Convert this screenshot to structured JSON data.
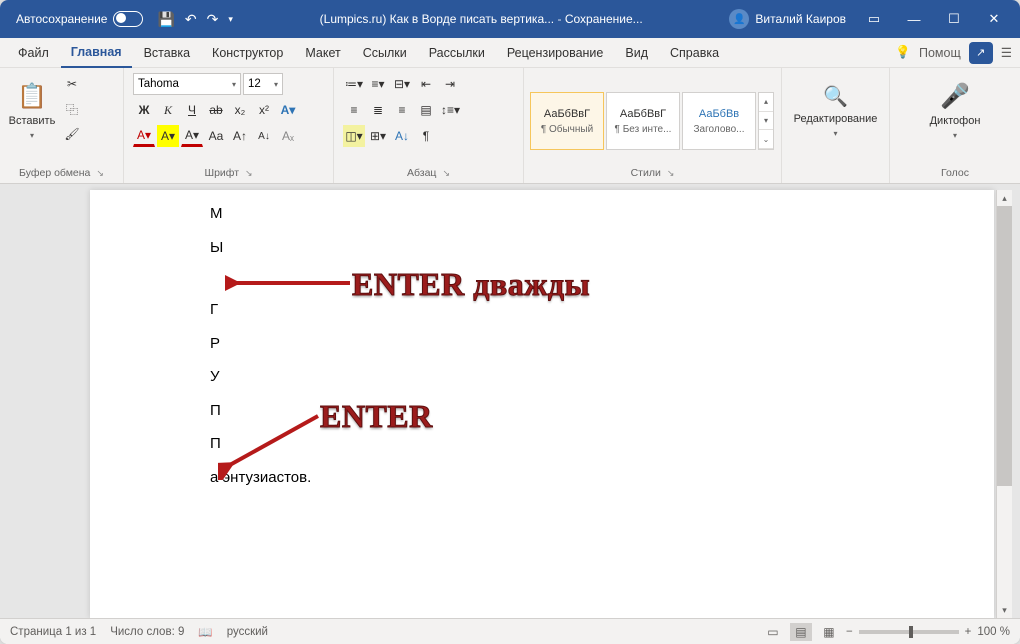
{
  "titlebar": {
    "autosave_label": "Автосохранение",
    "title": "(Lumpics.ru) Как в Ворде писать вертика...",
    "saving": "Сохранение...",
    "user": "Виталий Каиров"
  },
  "tabs": {
    "file": "Файл",
    "home": "Главная",
    "insert": "Вставка",
    "design": "Конструктор",
    "layout": "Макет",
    "references": "Ссылки",
    "mailings": "Рассылки",
    "review": "Рецензирование",
    "view": "Вид",
    "help": "Справка",
    "search": "Помощ"
  },
  "ribbon": {
    "clipboard": {
      "label": "Буфер обмена",
      "paste": "Вставить"
    },
    "font": {
      "label": "Шрифт",
      "name": "Tahoma",
      "size": "12",
      "bold": "Ж",
      "italic": "К",
      "underline": "Ч",
      "strike": "ab",
      "sub": "x₂",
      "sup": "x²",
      "color": "А",
      "highlight": "А",
      "effects": "А",
      "case": "Aa",
      "grow": "A",
      "shrink": "A",
      "clear": "A"
    },
    "paragraph": {
      "label": "Абзац"
    },
    "styles": {
      "label": "Стили",
      "items": [
        {
          "preview": "АаБбВвГ",
          "name": "¶ Обычный"
        },
        {
          "preview": "АаБбВвГ",
          "name": "¶ Без инте..."
        },
        {
          "preview": "АаБбВв",
          "name": "Заголово..."
        }
      ]
    },
    "editing": {
      "label": "Редактирование"
    },
    "voice": {
      "label": "Голос",
      "dictate": "Диктофон"
    }
  },
  "document": {
    "lines": [
      "М",
      "Ы",
      "",
      "Г",
      "Р",
      "У",
      "П",
      "П",
      "а энтузиастов."
    ]
  },
  "annotations": {
    "enter_twice": "ENTER дважды",
    "enter": "ENTER"
  },
  "statusbar": {
    "page": "Страница 1 из 1",
    "words": "Число слов: 9",
    "lang": "русский",
    "zoom": "100 %"
  }
}
